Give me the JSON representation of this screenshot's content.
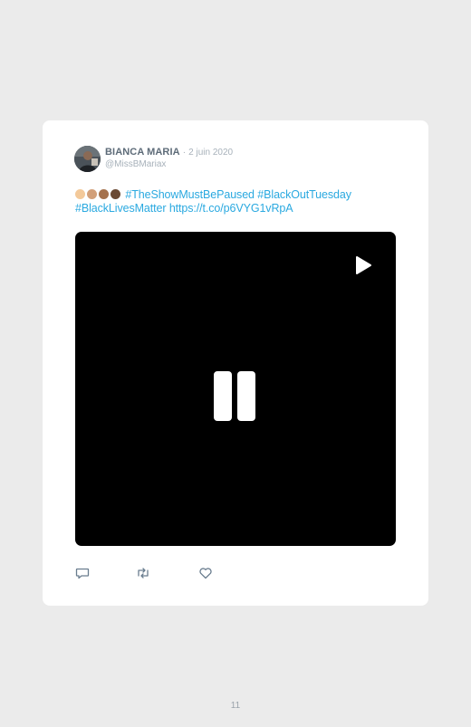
{
  "tweet": {
    "author_name": "BIANCA MARIA",
    "separator": "·",
    "date": "2 juin 2020",
    "handle": "@MissBMariax",
    "emojis": [
      "#f3c99a",
      "#d2a07a",
      "#a5724d",
      "#6b4a34"
    ],
    "hashtags": [
      "#TheShowMustBePaused",
      "#BlackOutTuesday",
      "#BlackLivesMatter"
    ],
    "link": "https://t.co/p6VYG1vRpA"
  },
  "video": {
    "state": "paused",
    "icons": [
      "play-icon",
      "pause-icon"
    ]
  },
  "actions": [
    "reply-icon",
    "retweet-icon",
    "like-icon"
  ],
  "colors": {
    "background": "#ebebeb",
    "card": "#ffffff",
    "link": "#2aa9e0",
    "name": "#5d6b78",
    "muted": "#a7b1ba",
    "icon": "#6a7d8f"
  },
  "page": {
    "number": "11"
  }
}
